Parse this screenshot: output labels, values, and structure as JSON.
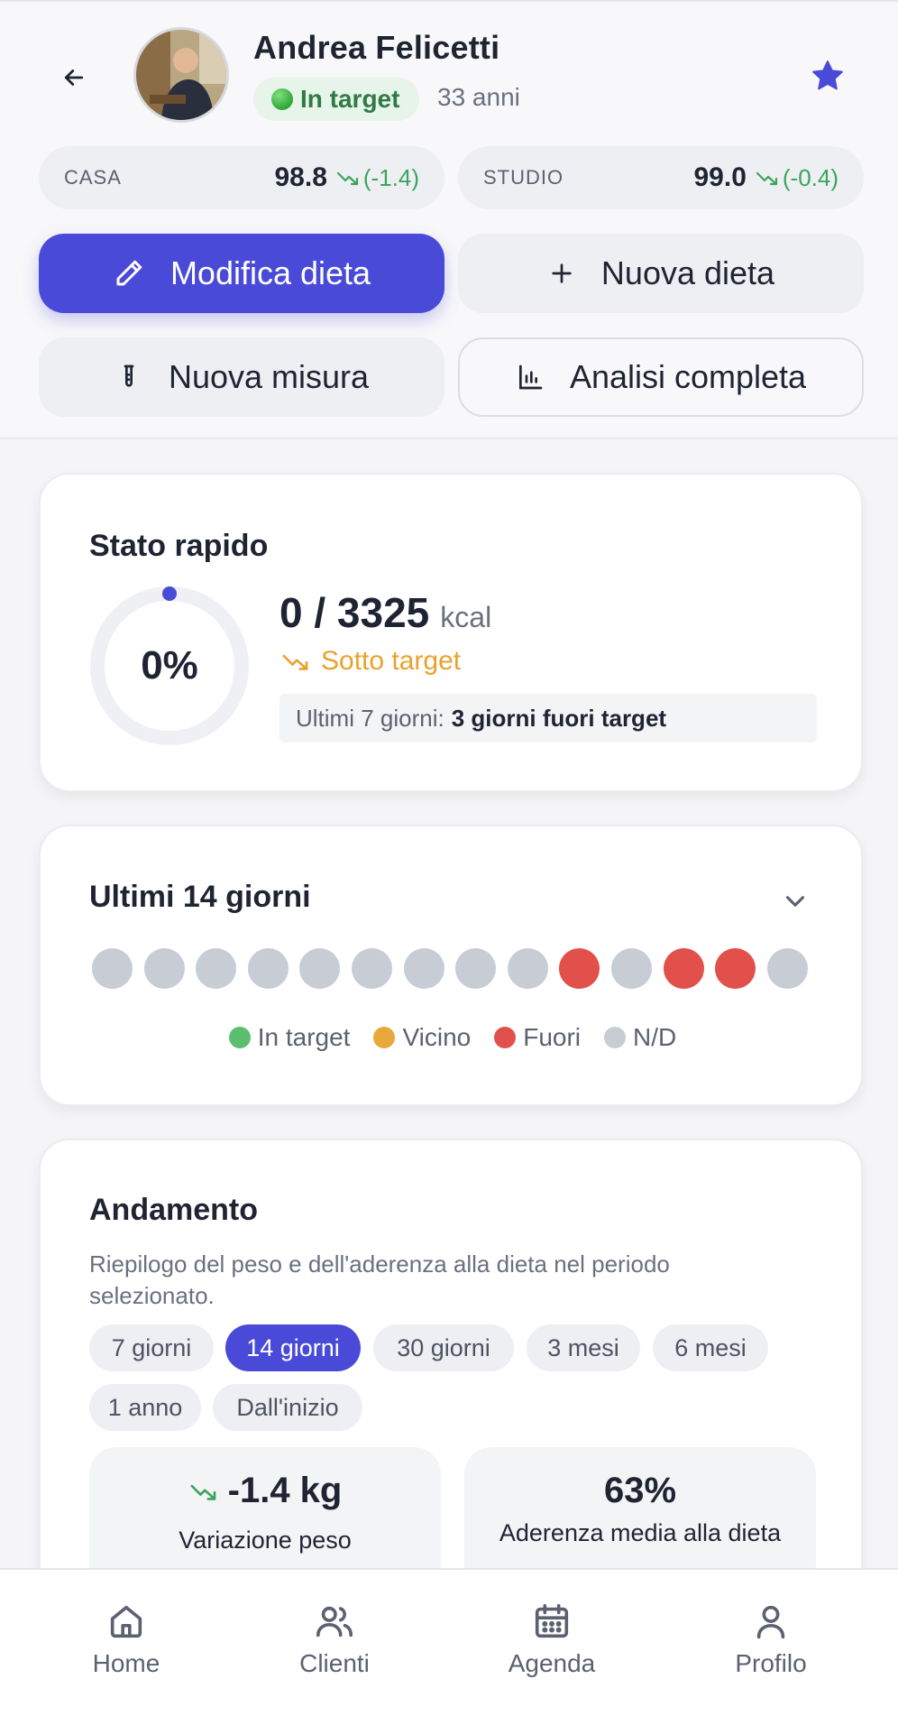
{
  "header": {
    "name": "Andrea Felicetti",
    "status": "In target",
    "age": "33 anni",
    "icons": {
      "back": "arrow-left-icon",
      "star": "star-icon"
    }
  },
  "weights": [
    {
      "label": "CASA",
      "value": "98.8",
      "delta": "(-1.4)"
    },
    {
      "label": "STUDIO",
      "value": "99.0",
      "delta": "(-0.4)"
    }
  ],
  "actions": {
    "edit_diet": "Modifica dieta",
    "new_diet": "Nuova dieta",
    "new_measure": "Nuova misura",
    "full_analysis": "Analisi completa"
  },
  "quick_status": {
    "title": "Stato rapido",
    "percent": "0%",
    "percent_value": 0,
    "kcal": "0 / 3325",
    "kcal_unit": "kcal",
    "under_target": "Sotto target",
    "days_label": "Ultimi 7 giorni:",
    "days_value": "3 giorni fuori target"
  },
  "last14": {
    "title": "Ultimi 14 giorni",
    "days": [
      "nd",
      "nd",
      "nd",
      "nd",
      "nd",
      "nd",
      "nd",
      "nd",
      "nd",
      "out",
      "nd",
      "out",
      "out",
      "nd"
    ],
    "legend": [
      {
        "label": "In target",
        "color": "#5cbf6f"
      },
      {
        "label": "Vicino",
        "color": "#e8a93a"
      },
      {
        "label": "Fuori",
        "color": "#e2504b"
      },
      {
        "label": "N/D",
        "color": "#c8ccd5"
      }
    ]
  },
  "trend": {
    "title": "Andamento",
    "description": "Riepilogo del peso e dell'aderenza alla dieta nel periodo selezionato.",
    "ranges": [
      "7 giorni",
      "14 giorni",
      "30 giorni",
      "3 mesi",
      "6 mesi",
      "1 anno",
      "Dall'inizio"
    ],
    "selected_range": "14 giorni",
    "weight_change": "-1.4 kg",
    "weight_change_label": "Variazione peso",
    "adherence": "63%",
    "adherence_label": "Aderenza media alla dieta"
  },
  "tabbar": [
    {
      "label": "Home",
      "icon": "home-icon"
    },
    {
      "label": "Clienti",
      "icon": "users-icon"
    },
    {
      "label": "Agenda",
      "icon": "calendar-icon"
    },
    {
      "label": "Profilo",
      "icon": "user-icon"
    }
  ],
  "colors": {
    "primary": "#4a4ad8",
    "success": "#3aa55b",
    "warning": "#e8a22e",
    "danger": "#e2504b"
  }
}
